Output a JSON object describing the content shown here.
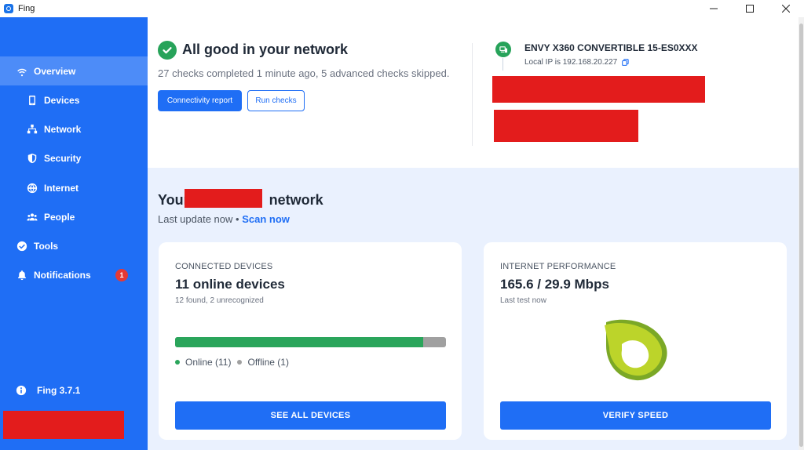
{
  "window": {
    "title": "Fing",
    "controls": [
      "minimize",
      "maximize",
      "close"
    ]
  },
  "sidebar": {
    "items": [
      {
        "label": "Overview",
        "icon": "wifi-icon",
        "active": true
      },
      {
        "label": "Devices",
        "icon": "phone-icon"
      },
      {
        "label": "Network",
        "icon": "network-icon"
      },
      {
        "label": "Security",
        "icon": "shield-icon"
      },
      {
        "label": "Internet",
        "icon": "globe-icon"
      },
      {
        "label": "People",
        "icon": "people-icon"
      },
      {
        "label": "Tools",
        "icon": "check-circle-icon"
      },
      {
        "label": "Notifications",
        "icon": "bell-icon",
        "badge": "1"
      }
    ],
    "version": "Fing 3.7.1"
  },
  "status": {
    "title": "All good in your network",
    "subtitle": "27 checks completed 1 minute ago, 5 advanced checks skipped.",
    "connectivity_button": "Connectivity report",
    "run_checks_button": "Run checks"
  },
  "device": {
    "name": "ENVY X360 CONVERTIBLE 15-ES0XXX",
    "local_ip": "Local IP is 192.168.20.227"
  },
  "network": {
    "title_prefix": "Your",
    "title_suffix": "network",
    "last_update": "Last update now •",
    "scan_now": "Scan now"
  },
  "devices_card": {
    "label": "CONNECTED DEVICES",
    "value": "11 online devices",
    "subtitle": "12 found, 2 unrecognized",
    "online_fraction": 0.917,
    "online_label": "Online (11)",
    "offline_label": "Offline (1)",
    "button": "SEE ALL DEVICES"
  },
  "internet_card": {
    "label": "INTERNET PERFORMANCE",
    "value": "165.6 / 29.9 Mbps",
    "subtitle": "Last test now",
    "button": "VERIFY SPEED"
  },
  "colors": {
    "sidebar": "#1f6ef5",
    "active_item": "#4d8cf8",
    "success": "#27a35a",
    "primary": "#1f6ef5",
    "badge": "#e53935",
    "redaction": "#e31c1c"
  }
}
